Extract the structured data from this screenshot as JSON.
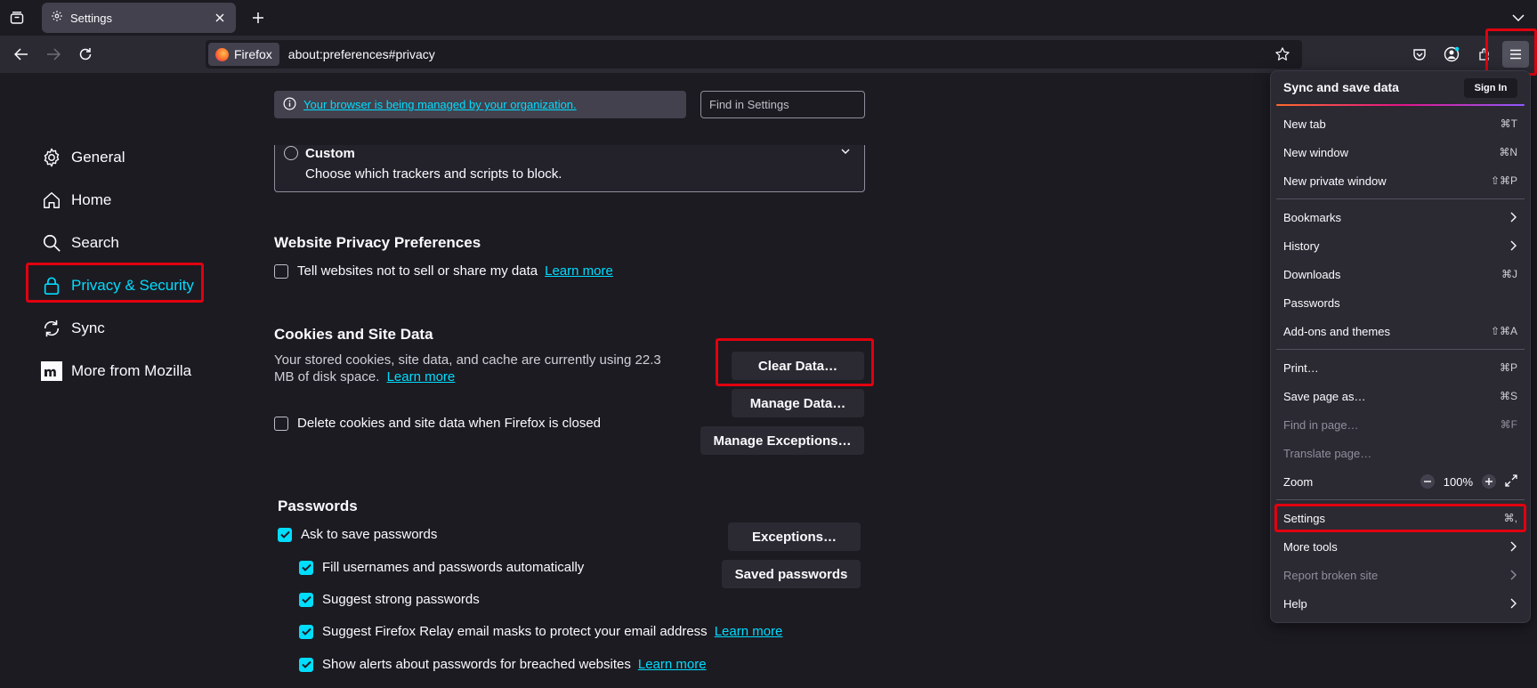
{
  "tab": {
    "title": "Settings"
  },
  "urlbar": {
    "identity": "Firefox",
    "url": "about:preferences#privacy"
  },
  "sidebar": {
    "items": [
      {
        "label": "General",
        "icon": "gear-icon"
      },
      {
        "label": "Home",
        "icon": "home-icon"
      },
      {
        "label": "Search",
        "icon": "search-icon"
      },
      {
        "label": "Privacy & Security",
        "icon": "lock-icon",
        "active": true
      },
      {
        "label": "Sync",
        "icon": "sync-icon"
      },
      {
        "label": "More from Mozilla",
        "icon": "mozilla-icon"
      }
    ]
  },
  "content": {
    "managed_notice": "Your browser is being managed by your organization.",
    "find_placeholder": "Find in Settings",
    "custom": {
      "title": "Custom",
      "desc": "Choose which trackers and scripts to block."
    },
    "website_privacy": {
      "heading": "Website Privacy Preferences",
      "checkbox": "Tell websites not to sell or share my data",
      "learn_more": "Learn more"
    },
    "cookies": {
      "heading": "Cookies and Site Data",
      "desc": "Your stored cookies, site data, and cache are currently using 22.3 MB of disk space.",
      "learn_more": "Learn more",
      "checkbox": "Delete cookies and site data when Firefox is closed",
      "clear_button": "Clear Data…",
      "manage_button": "Manage Data…",
      "exceptions_button": "Manage Exceptions…"
    },
    "passwords": {
      "heading": "Passwords",
      "ask_save": "Ask to save passwords",
      "autofill": "Fill usernames and passwords automatically",
      "suggest": "Suggest strong passwords",
      "relay": "Suggest Firefox Relay email masks to protect your email address",
      "relay_learn": "Learn more",
      "breach": "Show alerts about passwords for breached websites",
      "breach_learn": "Learn more",
      "exceptions_button": "Exceptions…",
      "saved_button": "Saved passwords"
    }
  },
  "appmenu": {
    "header": "Sync and save data",
    "signin": "Sign In",
    "items": [
      {
        "label": "New tab",
        "shortcut": "⌘T"
      },
      {
        "label": "New window",
        "shortcut": "⌘N"
      },
      {
        "label": "New private window",
        "shortcut": "⇧⌘P"
      },
      {
        "label": "Bookmarks",
        "shortcut": ""
      },
      {
        "label": "History",
        "shortcut": ""
      },
      {
        "label": "Downloads",
        "shortcut": "⌘J"
      },
      {
        "label": "Passwords",
        "shortcut": ""
      },
      {
        "label": "Add-ons and themes",
        "shortcut": "⇧⌘A"
      },
      {
        "label": "Print…",
        "shortcut": "⌘P"
      },
      {
        "label": "Save page as…",
        "shortcut": "⌘S"
      },
      {
        "label": "Find in page…",
        "shortcut": "⌘F"
      },
      {
        "label": "Translate page…",
        "shortcut": ""
      },
      {
        "label": "Zoom",
        "shortcut": ""
      },
      {
        "label": "Settings",
        "shortcut": "⌘,"
      },
      {
        "label": "More tools",
        "shortcut": ""
      },
      {
        "label": "Report broken site",
        "shortcut": ""
      },
      {
        "label": "Help",
        "shortcut": ""
      }
    ],
    "zoom_value": "100%"
  },
  "colors": {
    "accent": "#00ddff",
    "highlight": "#e1000f",
    "background": "#1c1b22"
  }
}
